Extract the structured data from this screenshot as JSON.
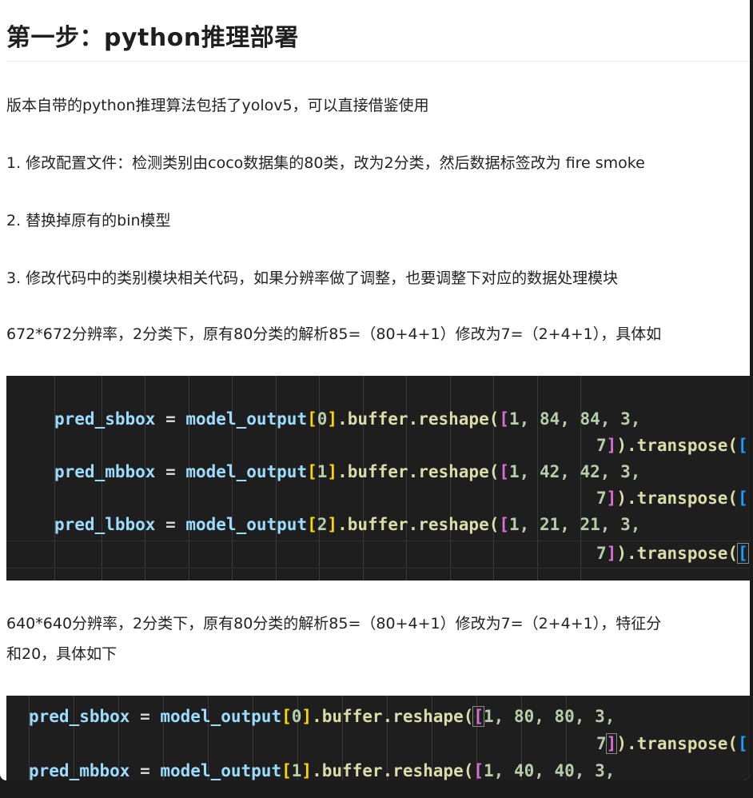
{
  "heading": "第一步：python推理部署",
  "paragraphs": {
    "intro": "版本自带的python推理算法包括了yolov5，可以直接借鉴使用",
    "step1": "1. 修改配置文件：检测类别由coco数据集的80类，改为2分类，然后数据标签改为 fire smoke",
    "step2": "2. 替换掉原有的bin模型",
    "step3": "3. 修改代码中的类别模块相关代码，如果分辨率做了调整，也要调整下对应的数据处理模块",
    "res672": "672*672分辨率，2分类下，原有80分类的解析85=（80+4+1）修改为7=（2+4+1），具体如",
    "res640_line1": "640*640分辨率，2分类下，原有80分类的解析85=（80+4+1）修改为7=（2+4+1），特征分",
    "res640_line2": "和20，具体如下"
  },
  "code_block_1": {
    "lines": [
      {
        "var": "pred_sbbox",
        "eq": " = ",
        "obj": "model_output",
        "idx": "0",
        "fn": ".buffer.reshape(",
        "args": "1, 84, 84, 3,"
      },
      {
        "cont": "7",
        "tail": ").transpose("
      },
      {
        "var": "pred_mbbox",
        "eq": " = ",
        "obj": "model_output",
        "idx": "1",
        "fn": ".buffer.reshape(",
        "args": "1, 42, 42, 3,"
      },
      {
        "cont": "7",
        "tail": ").transpose("
      },
      {
        "var": "pred_lbbox",
        "eq": " = ",
        "obj": "model_output",
        "idx": "2",
        "fn": ".buffer.reshape(",
        "args": "1, 21, 21, 3,"
      },
      {
        "cont": "7",
        "tail": ").transpose("
      }
    ]
  },
  "code_block_2": {
    "lines": [
      {
        "var": "pred_sbbox",
        "eq": " = ",
        "obj": "model_output",
        "idx": "0",
        "fn": ".buffer.reshape(",
        "args": "1, 80, 80, 3,"
      },
      {
        "cont": "7",
        "tail": ").transpose("
      },
      {
        "var": "pred_mbbox",
        "eq": " = ",
        "obj": "model_output",
        "idx": "1",
        "fn": ".buffer.reshape(",
        "args": "1, 40, 40, 3,"
      }
    ]
  },
  "colors": {
    "page_bg": "#ffffff",
    "code_bg": "#1e1e1e",
    "variable": "#9cdcfe",
    "function": "#dcdcaa",
    "number": "#b5cea8",
    "bracket_gold": "#ffd700",
    "bracket_violet": "#da70d6",
    "bracket_blue": "#179fff"
  }
}
